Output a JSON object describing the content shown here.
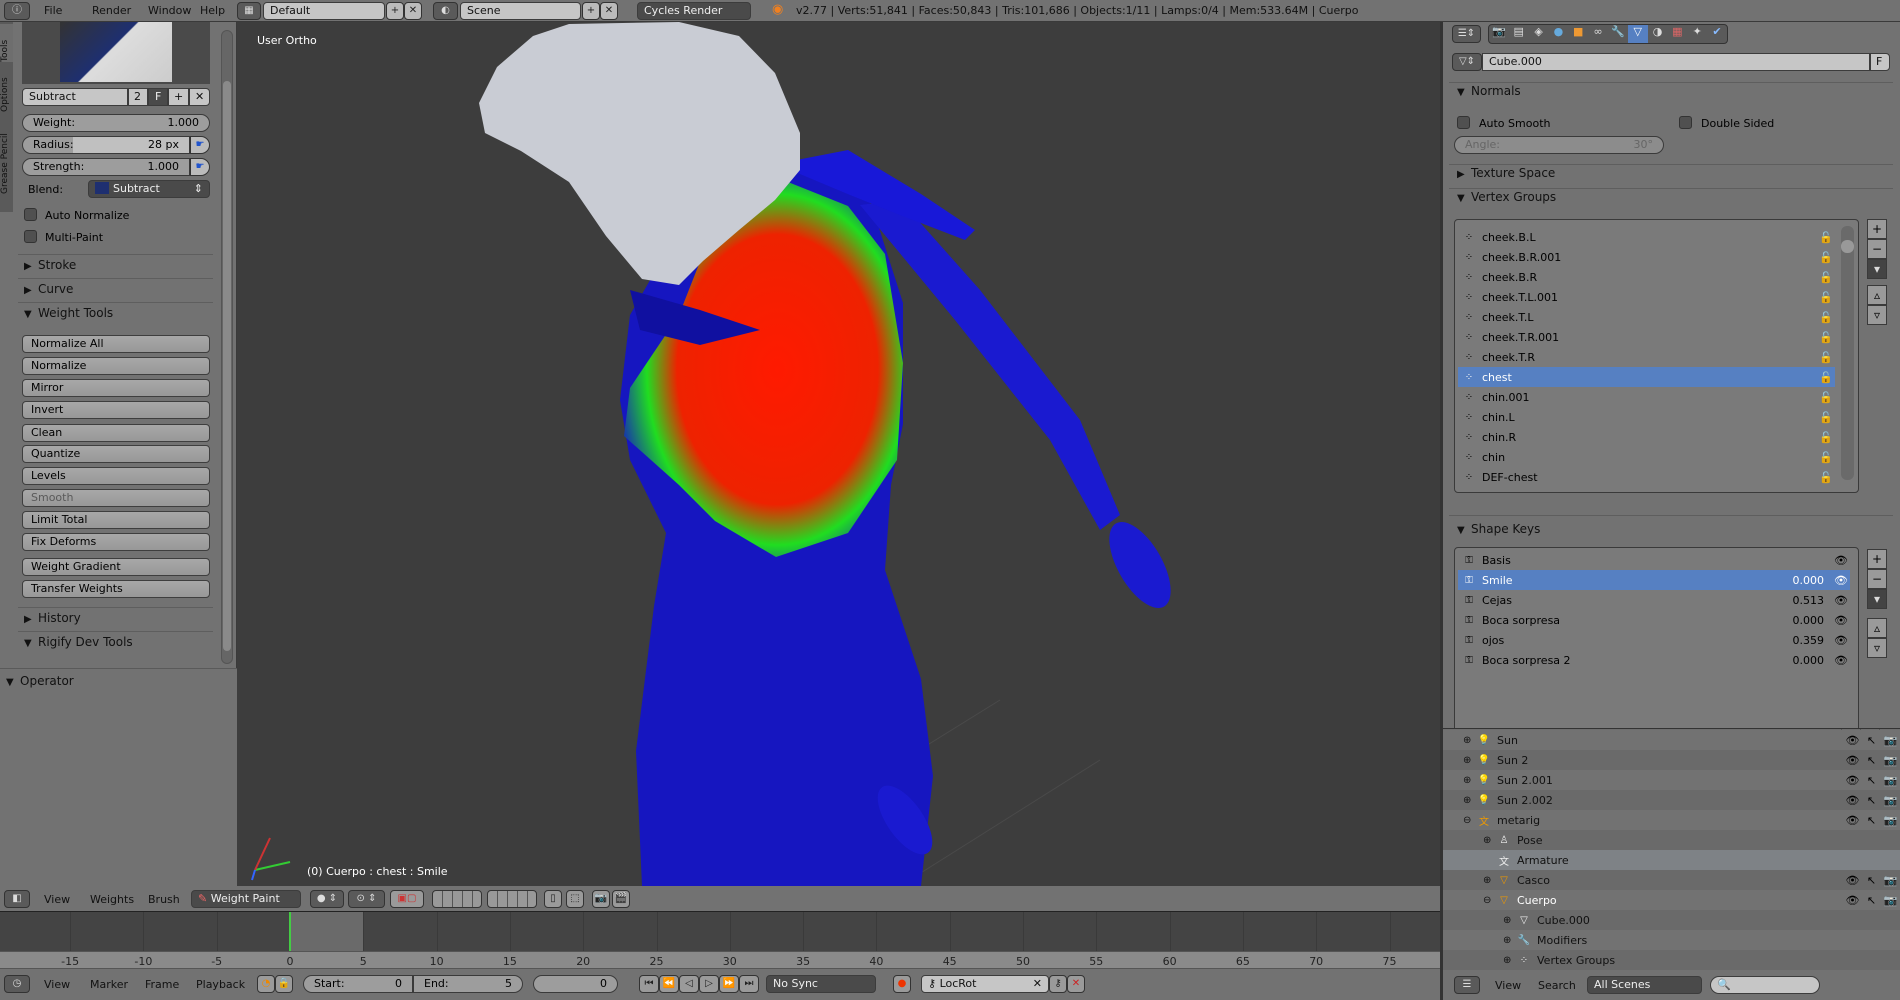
{
  "topbar": {
    "menus": [
      "File",
      "Render",
      "Window",
      "Help"
    ],
    "layout": "Default",
    "scene": "Scene",
    "engine": "Cycles Render",
    "stats": "v2.77 | Verts:51,841 | Faces:50,843 | Tris:101,686 | Objects:1/11 | Lamps:0/4 | Mem:533.64M | Cuerpo"
  },
  "toolshelf": {
    "tabs": [
      "Tools",
      "Options",
      "Grease Pencil"
    ],
    "brush_name": "Subtract",
    "brush_users": "2",
    "fake_user": "F",
    "weight_label": "Weight:",
    "weight": "1.000",
    "radius_label": "Radius:",
    "radius": "28 px",
    "strength_label": "Strength:",
    "strength": "1.000",
    "blend_label": "Blend:",
    "blend": "Subtract",
    "auto_normalize": "Auto Normalize",
    "multi_paint": "Multi-Paint",
    "stroke": "Stroke",
    "curve": "Curve",
    "weight_tools": "Weight Tools",
    "buttons": [
      {
        "label": "Normalize All"
      },
      {
        "label": "Normalize"
      },
      {
        "label": "Mirror"
      },
      {
        "label": "Invert"
      },
      {
        "label": "Clean"
      },
      {
        "label": "Quantize"
      },
      {
        "label": "Levels"
      },
      {
        "label": "Smooth",
        "disabled": true
      },
      {
        "label": "Limit Total"
      },
      {
        "label": "Fix Deforms"
      },
      {
        "label": "Weight Gradient"
      },
      {
        "label": "Transfer Weights"
      }
    ],
    "history": "History",
    "rigify": "Rigify Dev Tools",
    "operator": "Operator"
  },
  "viewport": {
    "view_name": "User Ortho",
    "status": "(0) Cuerpo : chest : Smile",
    "colors": {
      "bg": "#3d3d3d",
      "body": "#1414c8",
      "hot": "#ff1a00",
      "mid": "#22dd22"
    }
  },
  "view3d_header": {
    "menus": [
      "View",
      "Weights",
      "Brush"
    ],
    "mode": "Weight Paint"
  },
  "timeline": {
    "ticks": [
      -15,
      -10,
      -5,
      0,
      5,
      10,
      15,
      20,
      25,
      30,
      35,
      40,
      45,
      50,
      55,
      60,
      65,
      70,
      75
    ],
    "current_frame": 0,
    "preview_end": 5,
    "menus": [
      "View",
      "Marker",
      "Frame",
      "Playback"
    ],
    "start_label": "Start:",
    "start": "0",
    "end_label": "End:",
    "end": "5",
    "frame": "0",
    "sync": "No Sync",
    "keying_set": "LocRot"
  },
  "properties": {
    "mesh_name": "Cube.000",
    "fake": "F",
    "normals": "Normals",
    "auto_smooth": "Auto Smooth",
    "double_sided": "Double Sided",
    "angle_label": "Angle:",
    "angle": "30°",
    "texture_space": "Texture Space",
    "vertex_groups_title": "Vertex Groups",
    "vertex_groups": [
      {
        "name": "cheek.B.L"
      },
      {
        "name": "cheek.B.R.001"
      },
      {
        "name": "cheek.B.R"
      },
      {
        "name": "cheek.T.L.001"
      },
      {
        "name": "cheek.T.L"
      },
      {
        "name": "cheek.T.R.001"
      },
      {
        "name": "cheek.T.R"
      },
      {
        "name": "chest",
        "selected": true
      },
      {
        "name": "chin.001"
      },
      {
        "name": "chin.L"
      },
      {
        "name": "chin.R"
      },
      {
        "name": "chin"
      },
      {
        "name": "DEF-chest"
      }
    ],
    "shape_keys_title": "Shape Keys",
    "shape_keys": [
      {
        "name": "Basis",
        "value": ""
      },
      {
        "name": "Smile",
        "value": "0.000",
        "selected": true
      },
      {
        "name": "Cejas",
        "value": "0.513"
      },
      {
        "name": "Boca sorpresa",
        "value": "0.000"
      },
      {
        "name": "ojos",
        "value": "0.359"
      },
      {
        "name": "Boca sorpresa 2",
        "value": "0.000"
      }
    ]
  },
  "outliner": {
    "rows": [
      {
        "name": "Sun",
        "indent": 0,
        "icon": "lamp",
        "vis": true
      },
      {
        "name": "Sun 2",
        "indent": 0,
        "icon": "lamp",
        "vis": true
      },
      {
        "name": "Sun 2.001",
        "indent": 0,
        "icon": "lamp",
        "vis": true
      },
      {
        "name": "Sun 2.002",
        "indent": 0,
        "icon": "lamp",
        "vis": true
      },
      {
        "name": "metarig",
        "indent": 0,
        "icon": "armature",
        "vis": true
      },
      {
        "name": "Pose",
        "indent": 1,
        "icon": "pose"
      },
      {
        "name": "Armature",
        "indent": 1,
        "icon": "armature-data",
        "highlight": true
      },
      {
        "name": "Casco",
        "indent": 1,
        "icon": "mesh",
        "vis": true
      },
      {
        "name": "Cuerpo",
        "indent": 1,
        "icon": "mesh",
        "vis": true,
        "active": true
      },
      {
        "name": "Cube.000",
        "indent": 2,
        "icon": "mesh-data"
      },
      {
        "name": "Modifiers",
        "indent": 2,
        "icon": "wrench"
      },
      {
        "name": "Vertex Groups",
        "indent": 2,
        "icon": "vgroup"
      }
    ],
    "menus": [
      "View",
      "Search"
    ],
    "filter": "All Scenes"
  }
}
